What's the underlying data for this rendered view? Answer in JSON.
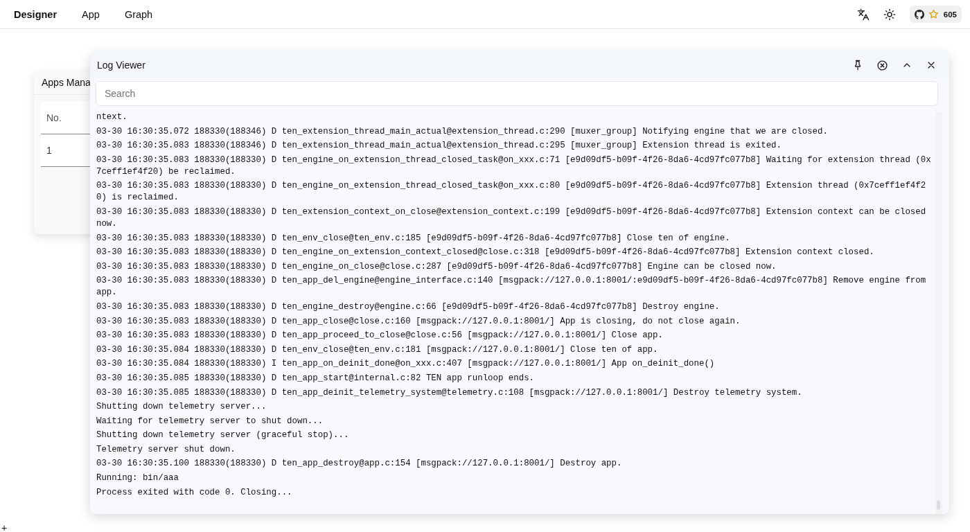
{
  "top_bar": {
    "brand": "Designer",
    "menu": [
      "App",
      "Graph"
    ],
    "github_stars": "605"
  },
  "apps_manager": {
    "title": "Apps Mana",
    "columns": [
      "No."
    ],
    "rows": [
      [
        "1"
      ]
    ]
  },
  "log_viewer": {
    "title": "Log Viewer",
    "search": {
      "placeholder": "Search"
    },
    "lines": [
      "ntext.",
      "03-30 16:30:35.072 188330(188346) D ten_extension_thread_main_actual@extension_thread.c:290 [muxer_group] Notifying engine that we are closed.",
      "03-30 16:30:35.083 188330(188346) D ten_extension_thread_main_actual@extension_thread.c:295 [muxer_group] Extension thread is exited.",
      "03-30 16:30:35.083 188330(188330) D ten_engine_on_extension_thread_closed_task@on_xxx.c:71 [e9d09df5-b09f-4f26-8da6-4cd97fc077b8] Waiting for extension thread (0x7ceff1ef4f20) be reclaimed.",
      "03-30 16:30:35.083 188330(188330) D ten_engine_on_extension_thread_closed_task@on_xxx.c:80 [e9d09df5-b09f-4f26-8da6-4cd97fc077b8] Extension thread (0x7ceff1ef4f20) is reclaimed.",
      "03-30 16:30:35.083 188330(188330) D ten_extension_context_on_close@extension_context.c:199 [e9d09df5-b09f-4f26-8da6-4cd97fc077b8] Extension context can be closed now.",
      "03-30 16:30:35.083 188330(188330) D ten_env_close@ten_env.c:185 [e9d09df5-b09f-4f26-8da6-4cd97fc077b8] Close ten of engine.",
      "03-30 16:30:35.083 188330(188330) D ten_engine_on_extension_context_closed@close.c:318 [e9d09df5-b09f-4f26-8da6-4cd97fc077b8] Extension context closed.",
      "03-30 16:30:35.083 188330(188330) D ten_engine_on_close@close.c:287 [e9d09df5-b09f-4f26-8da6-4cd97fc077b8] Engine can be closed now.",
      "03-30 16:30:35.083 188330(188330) D ten_app_del_engine@engine_interface.c:140 [msgpack://127.0.0.1:8001/:e9d09df5-b09f-4f26-8da6-4cd97fc077b8] Remove engine from app.",
      "03-30 16:30:35.083 188330(188330) D ten_engine_destroy@engine.c:66 [e9d09df5-b09f-4f26-8da6-4cd97fc077b8] Destroy engine.",
      "03-30 16:30:35.083 188330(188330) D ten_app_close@close.c:160 [msgpack://127.0.0.1:8001/] App is closing, do not close again.",
      "03-30 16:30:35.083 188330(188330) D ten_app_proceed_to_close@close.c:56 [msgpack://127.0.0.1:8001/] Close app.",
      "03-30 16:30:35.084 188330(188330) D ten_env_close@ten_env.c:181 [msgpack://127.0.0.1:8001/] Close ten of app.",
      "03-30 16:30:35.084 188330(188330) I ten_app_on_deinit_done@on_xxx.c:407 [msgpack://127.0.0.1:8001/] App on_deinit_done()",
      "03-30 16:30:35.085 188330(188330) D ten_app_start@internal.c:82 TEN app runloop ends.",
      "03-30 16:30:35.085 188330(188330) D ten_app_deinit_telemetry_system@telemetry.c:108 [msgpack://127.0.0.1:8001/] Destroy telemetry system.",
      "Shutting down telemetry server...",
      "Waiting for telemetry server to shut down...",
      "Shutting down telemetry server (graceful stop)...",
      "Telemetry server shut down.",
      "03-30 16:30:35.100 188330(188330) D ten_app_destroy@app.c:154 [msgpack://127.0.0.1:8001/] Destroy app.",
      "Running: bin/aaa",
      "Process exited with code 0. Closing..."
    ]
  },
  "corner_button": "+"
}
